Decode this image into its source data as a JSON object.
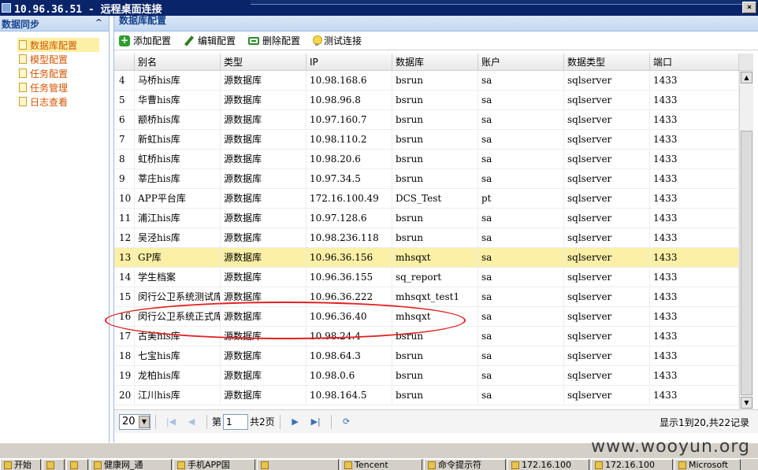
{
  "window": {
    "title": "10.96.36.51 - 远程桌面连接",
    "close_label": "×"
  },
  "left_panel": {
    "title": "数据同步",
    "collapse_icon": "^",
    "items": [
      {
        "label": "数据库配置",
        "selected": true
      },
      {
        "label": "模型配置"
      },
      {
        "label": "任务配置"
      },
      {
        "label": "任务管理"
      },
      {
        "label": "日志查看"
      }
    ]
  },
  "main_panel": {
    "title": "数据库配置",
    "toolbar": {
      "add": "添加配置",
      "edit": "编辑配置",
      "delete": "删除配置",
      "test": "测试连接"
    },
    "columns": [
      "别名",
      "类型",
      "IP",
      "数据库",
      "账户",
      "数据类型",
      "端口"
    ],
    "rows": [
      {
        "num": "4",
        "name": "马桥his库",
        "type": "源数据库",
        "ip": "10.98.168.6",
        "db": "bsrun",
        "acc": "sa",
        "dbtype": "sqlserver",
        "port": "1433"
      },
      {
        "num": "5",
        "name": "华曹his库",
        "type": "源数据库",
        "ip": "10.98.96.8",
        "db": "bsrun",
        "acc": "sa",
        "dbtype": "sqlserver",
        "port": "1433"
      },
      {
        "num": "6",
        "name": "颛桥his库",
        "type": "源数据库",
        "ip": "10.97.160.7",
        "db": "bsrun",
        "acc": "sa",
        "dbtype": "sqlserver",
        "port": "1433"
      },
      {
        "num": "7",
        "name": "新虹his库",
        "type": "源数据库",
        "ip": "10.98.110.2",
        "db": "bsrun",
        "acc": "sa",
        "dbtype": "sqlserver",
        "port": "1433"
      },
      {
        "num": "8",
        "name": "虹桥his库",
        "type": "源数据库",
        "ip": "10.98.20.6",
        "db": "bsrun",
        "acc": "sa",
        "dbtype": "sqlserver",
        "port": "1433"
      },
      {
        "num": "9",
        "name": "莘庄his库",
        "type": "源数据库",
        "ip": "10.97.34.5",
        "db": "bsrun",
        "acc": "sa",
        "dbtype": "sqlserver",
        "port": "1433"
      },
      {
        "num": "10",
        "name": "APP平台库",
        "type": "源数据库",
        "ip": "172.16.100.49",
        "db": "DCS_Test",
        "acc": "pt",
        "dbtype": "sqlserver",
        "port": "1433"
      },
      {
        "num": "11",
        "name": "浦江his库",
        "type": "源数据库",
        "ip": "10.97.128.6",
        "db": "bsrun",
        "acc": "sa",
        "dbtype": "sqlserver",
        "port": "1433"
      },
      {
        "num": "12",
        "name": "吴泾his库",
        "type": "源数据库",
        "ip": "10.98.236.118",
        "db": "bsrun",
        "acc": "sa",
        "dbtype": "sqlserver",
        "port": "1433"
      },
      {
        "num": "13",
        "name": "GP库",
        "type": "源数据库",
        "ip": "10.96.36.156",
        "db": "mhsqxt",
        "acc": "sa",
        "dbtype": "sqlserver",
        "port": "1433",
        "highlight": true
      },
      {
        "num": "14",
        "name": "学生档案",
        "type": "源数据库",
        "ip": "10.96.36.155",
        "db": "sq_report",
        "acc": "sa",
        "dbtype": "sqlserver",
        "port": "1433"
      },
      {
        "num": "15",
        "name": "闵行公卫系统测试库",
        "type": "源数据库",
        "ip": "10.96.36.222",
        "db": "mhsqxt_test1",
        "acc": "sa",
        "dbtype": "sqlserver",
        "port": "1433"
      },
      {
        "num": "16",
        "name": "闵行公卫系统正式库",
        "type": "源数据库",
        "ip": "10.96.36.40",
        "db": "mhsqxt",
        "acc": "sa",
        "dbtype": "sqlserver",
        "port": "1433"
      },
      {
        "num": "17",
        "name": "古美his库",
        "type": "源数据库",
        "ip": "10.98.24.4",
        "db": "bsrun",
        "acc": "sa",
        "dbtype": "sqlserver",
        "port": "1433"
      },
      {
        "num": "18",
        "name": "七宝his库",
        "type": "源数据库",
        "ip": "10.98.64.3",
        "db": "bsrun",
        "acc": "sa",
        "dbtype": "sqlserver",
        "port": "1433"
      },
      {
        "num": "19",
        "name": "龙柏his库",
        "type": "源数据库",
        "ip": "10.98.0.6",
        "db": "bsrun",
        "acc": "sa",
        "dbtype": "sqlserver",
        "port": "1433"
      },
      {
        "num": "20",
        "name": "江川his库",
        "type": "源数据库",
        "ip": "10.98.164.5",
        "db": "bsrun",
        "acc": "sa",
        "dbtype": "sqlserver",
        "port": "1433"
      }
    ],
    "pager": {
      "page_size": "20",
      "page_label_prefix": "第",
      "current_page": "1",
      "page_label_suffix": "共2页",
      "info": "显示1到20,共22记录"
    }
  },
  "taskbar": {
    "start": "开始",
    "items": [
      "",
      "",
      "健康网_通",
      "手机APP国",
      "",
      "Tencent",
      "命令提示符",
      "172.16.100",
      "172.16.100",
      "Microsoft"
    ]
  },
  "watermark": "www.wooyun.org",
  "colors": {
    "highlight_row": "#fbf0a6",
    "accent": "#15428b",
    "annotation": "#e02020"
  }
}
